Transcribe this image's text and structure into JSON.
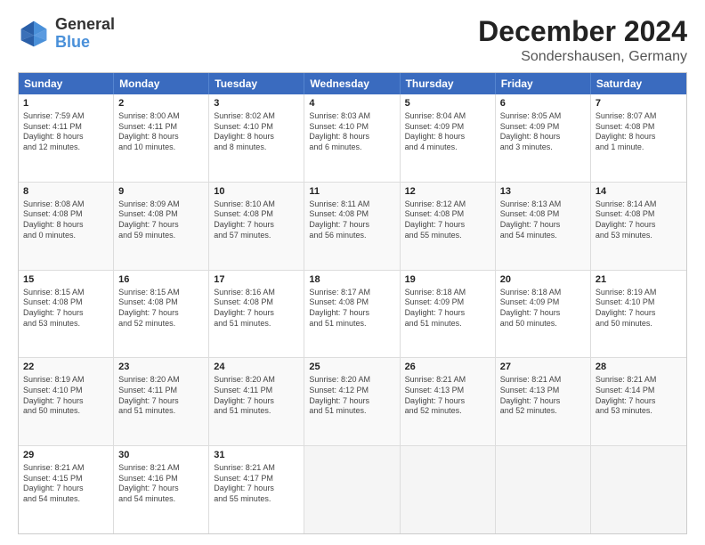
{
  "logo": {
    "line1": "General",
    "line2": "Blue"
  },
  "title": "December 2024",
  "subtitle": "Sondershausen, Germany",
  "header_days": [
    "Sunday",
    "Monday",
    "Tuesday",
    "Wednesday",
    "Thursday",
    "Friday",
    "Saturday"
  ],
  "weeks": [
    [
      {
        "day": "1",
        "lines": [
          "Sunrise: 7:59 AM",
          "Sunset: 4:11 PM",
          "Daylight: 8 hours",
          "and 12 minutes."
        ]
      },
      {
        "day": "2",
        "lines": [
          "Sunrise: 8:00 AM",
          "Sunset: 4:11 PM",
          "Daylight: 8 hours",
          "and 10 minutes."
        ]
      },
      {
        "day": "3",
        "lines": [
          "Sunrise: 8:02 AM",
          "Sunset: 4:10 PM",
          "Daylight: 8 hours",
          "and 8 minutes."
        ]
      },
      {
        "day": "4",
        "lines": [
          "Sunrise: 8:03 AM",
          "Sunset: 4:10 PM",
          "Daylight: 8 hours",
          "and 6 minutes."
        ]
      },
      {
        "day": "5",
        "lines": [
          "Sunrise: 8:04 AM",
          "Sunset: 4:09 PM",
          "Daylight: 8 hours",
          "and 4 minutes."
        ]
      },
      {
        "day": "6",
        "lines": [
          "Sunrise: 8:05 AM",
          "Sunset: 4:09 PM",
          "Daylight: 8 hours",
          "and 3 minutes."
        ]
      },
      {
        "day": "7",
        "lines": [
          "Sunrise: 8:07 AM",
          "Sunset: 4:08 PM",
          "Daylight: 8 hours",
          "and 1 minute."
        ]
      }
    ],
    [
      {
        "day": "8",
        "lines": [
          "Sunrise: 8:08 AM",
          "Sunset: 4:08 PM",
          "Daylight: 8 hours",
          "and 0 minutes."
        ]
      },
      {
        "day": "9",
        "lines": [
          "Sunrise: 8:09 AM",
          "Sunset: 4:08 PM",
          "Daylight: 7 hours",
          "and 59 minutes."
        ]
      },
      {
        "day": "10",
        "lines": [
          "Sunrise: 8:10 AM",
          "Sunset: 4:08 PM",
          "Daylight: 7 hours",
          "and 57 minutes."
        ]
      },
      {
        "day": "11",
        "lines": [
          "Sunrise: 8:11 AM",
          "Sunset: 4:08 PM",
          "Daylight: 7 hours",
          "and 56 minutes."
        ]
      },
      {
        "day": "12",
        "lines": [
          "Sunrise: 8:12 AM",
          "Sunset: 4:08 PM",
          "Daylight: 7 hours",
          "and 55 minutes."
        ]
      },
      {
        "day": "13",
        "lines": [
          "Sunrise: 8:13 AM",
          "Sunset: 4:08 PM",
          "Daylight: 7 hours",
          "and 54 minutes."
        ]
      },
      {
        "day": "14",
        "lines": [
          "Sunrise: 8:14 AM",
          "Sunset: 4:08 PM",
          "Daylight: 7 hours",
          "and 53 minutes."
        ]
      }
    ],
    [
      {
        "day": "15",
        "lines": [
          "Sunrise: 8:15 AM",
          "Sunset: 4:08 PM",
          "Daylight: 7 hours",
          "and 53 minutes."
        ]
      },
      {
        "day": "16",
        "lines": [
          "Sunrise: 8:15 AM",
          "Sunset: 4:08 PM",
          "Daylight: 7 hours",
          "and 52 minutes."
        ]
      },
      {
        "day": "17",
        "lines": [
          "Sunrise: 8:16 AM",
          "Sunset: 4:08 PM",
          "Daylight: 7 hours",
          "and 51 minutes."
        ]
      },
      {
        "day": "18",
        "lines": [
          "Sunrise: 8:17 AM",
          "Sunset: 4:08 PM",
          "Daylight: 7 hours",
          "and 51 minutes."
        ]
      },
      {
        "day": "19",
        "lines": [
          "Sunrise: 8:18 AM",
          "Sunset: 4:09 PM",
          "Daylight: 7 hours",
          "and 51 minutes."
        ]
      },
      {
        "day": "20",
        "lines": [
          "Sunrise: 8:18 AM",
          "Sunset: 4:09 PM",
          "Daylight: 7 hours",
          "and 50 minutes."
        ]
      },
      {
        "day": "21",
        "lines": [
          "Sunrise: 8:19 AM",
          "Sunset: 4:10 PM",
          "Daylight: 7 hours",
          "and 50 minutes."
        ]
      }
    ],
    [
      {
        "day": "22",
        "lines": [
          "Sunrise: 8:19 AM",
          "Sunset: 4:10 PM",
          "Daylight: 7 hours",
          "and 50 minutes."
        ]
      },
      {
        "day": "23",
        "lines": [
          "Sunrise: 8:20 AM",
          "Sunset: 4:11 PM",
          "Daylight: 7 hours",
          "and 51 minutes."
        ]
      },
      {
        "day": "24",
        "lines": [
          "Sunrise: 8:20 AM",
          "Sunset: 4:11 PM",
          "Daylight: 7 hours",
          "and 51 minutes."
        ]
      },
      {
        "day": "25",
        "lines": [
          "Sunrise: 8:20 AM",
          "Sunset: 4:12 PM",
          "Daylight: 7 hours",
          "and 51 minutes."
        ]
      },
      {
        "day": "26",
        "lines": [
          "Sunrise: 8:21 AM",
          "Sunset: 4:13 PM",
          "Daylight: 7 hours",
          "and 52 minutes."
        ]
      },
      {
        "day": "27",
        "lines": [
          "Sunrise: 8:21 AM",
          "Sunset: 4:13 PM",
          "Daylight: 7 hours",
          "and 52 minutes."
        ]
      },
      {
        "day": "28",
        "lines": [
          "Sunrise: 8:21 AM",
          "Sunset: 4:14 PM",
          "Daylight: 7 hours",
          "and 53 minutes."
        ]
      }
    ],
    [
      {
        "day": "29",
        "lines": [
          "Sunrise: 8:21 AM",
          "Sunset: 4:15 PM",
          "Daylight: 7 hours",
          "and 54 minutes."
        ]
      },
      {
        "day": "30",
        "lines": [
          "Sunrise: 8:21 AM",
          "Sunset: 4:16 PM",
          "Daylight: 7 hours",
          "and 54 minutes."
        ]
      },
      {
        "day": "31",
        "lines": [
          "Sunrise: 8:21 AM",
          "Sunset: 4:17 PM",
          "Daylight: 7 hours",
          "and 55 minutes."
        ]
      },
      {
        "day": "",
        "lines": []
      },
      {
        "day": "",
        "lines": []
      },
      {
        "day": "",
        "lines": []
      },
      {
        "day": "",
        "lines": []
      }
    ]
  ]
}
